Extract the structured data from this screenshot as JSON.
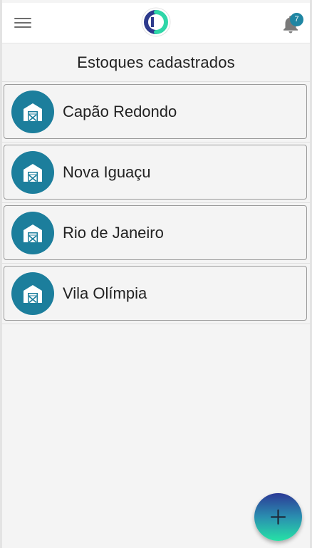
{
  "header": {
    "menu_icon": "hamburger-menu-icon",
    "logo_icon": "brand-logo-icon",
    "notification_icon": "bell-icon",
    "notification_count": "7"
  },
  "page": {
    "title": "Estoques cadastrados"
  },
  "stocks": [
    {
      "label": "Capão Redondo",
      "icon": "warehouse-icon"
    },
    {
      "label": "Nova Iguaçu",
      "icon": "warehouse-icon"
    },
    {
      "label": "Rio de Janeiro",
      "icon": "warehouse-icon"
    },
    {
      "label": "Vila Olímpia",
      "icon": "warehouse-icon"
    }
  ],
  "fab": {
    "icon": "plus-icon"
  },
  "colors": {
    "accent": "#1c7e9c",
    "badge": "#1f86a3",
    "fab_gradient_top": "#2c3a96",
    "fab_gradient_bottom": "#26e2a6",
    "background": "#f4f4f4"
  }
}
